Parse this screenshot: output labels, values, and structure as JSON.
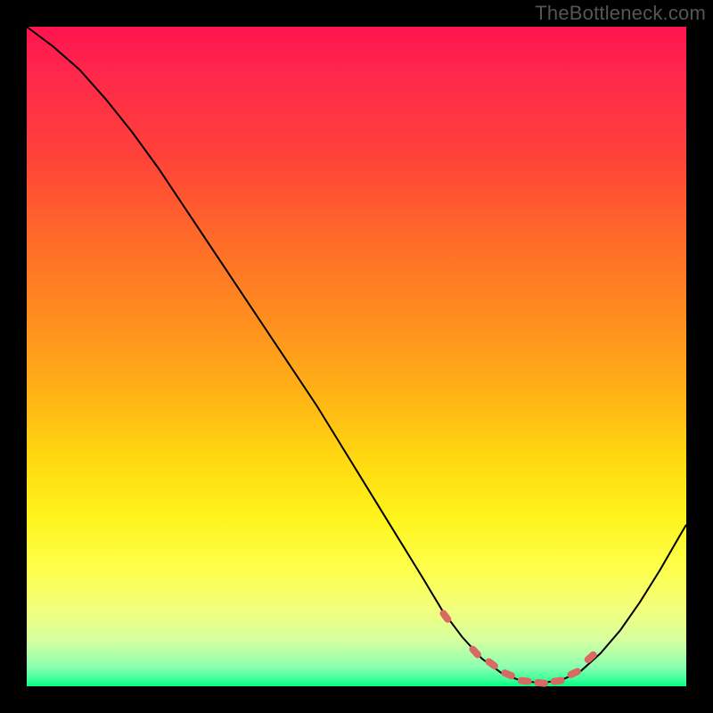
{
  "watermark": "TheBottleneck.com",
  "colors": {
    "page_bg": "#000000",
    "curve": "#000000",
    "bead": "#d86a63",
    "gradient_top": "#ff1450",
    "gradient_bottom": "#00ff80"
  },
  "chart_data": {
    "type": "line",
    "title": "",
    "xlabel": "",
    "ylabel": "",
    "xlim": [
      0,
      100
    ],
    "ylim": [
      0,
      100
    ],
    "grid": false,
    "legend": false,
    "series": [
      {
        "name": "bottleneck-curve",
        "x": [
          0,
          4,
          8,
          12,
          16,
          20,
          24,
          28,
          32,
          36,
          40,
          44,
          48,
          52,
          56,
          60,
          63,
          66,
          69,
          72,
          75,
          78,
          81,
          84,
          87,
          90,
          93,
          96,
          99,
          100
        ],
        "values": [
          100,
          97,
          93.5,
          89,
          84,
          78.5,
          72.5,
          66.5,
          60.5,
          54.5,
          48.5,
          42.5,
          36,
          29.5,
          23,
          16.5,
          11.5,
          7.5,
          4.2,
          2.0,
          0.8,
          0.5,
          0.9,
          2.3,
          5.0,
          8.5,
          12.8,
          17.6,
          22.8,
          24.5
        ]
      }
    ],
    "markers": {
      "name": "highlighted-points",
      "x": [
        63.5,
        68.0,
        70.5,
        73.0,
        75.5,
        78.0,
        80.5,
        83.0,
        85.5
      ],
      "values": [
        10.6,
        5.2,
        3.4,
        1.8,
        0.8,
        0.5,
        0.8,
        2.0,
        4.4
      ],
      "style": "pill"
    },
    "notes": "Axis ticks and units are not shown in the source image; x and y are normalized 0–100. Curve depicts bottleneck % (y) vs. component balance (x); minimum ≈ x 78, y 0.5."
  }
}
